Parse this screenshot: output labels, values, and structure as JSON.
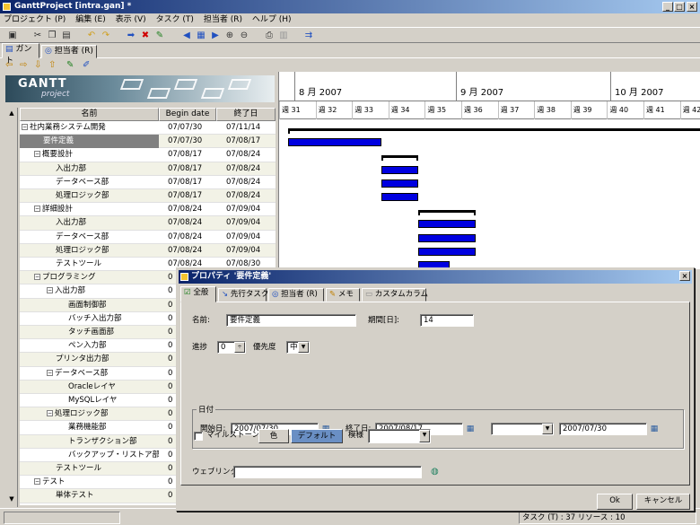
{
  "window": {
    "title": "GanttProject [intra.gan] *"
  },
  "menu": [
    "プロジェクト (P)",
    "編集 (E)",
    "表示 (V)",
    "タスク (T)",
    "担当者 (R)",
    "ヘルプ (H)"
  ],
  "tabs": [
    {
      "label": "ガント"
    },
    {
      "label": "担当者 (R)"
    }
  ],
  "logo": {
    "text": "GANTT",
    "sub": "project"
  },
  "table": {
    "headers": {
      "name": "名前",
      "begin": "Begin date",
      "end": "終了日"
    },
    "rows": [
      {
        "name": "社内業務システム開発",
        "begin": "07/07/30",
        "end": "07/11/14",
        "level": 0,
        "toggle": "−"
      },
      {
        "name": "要件定義",
        "begin": "07/07/30",
        "end": "07/08/17",
        "level": 1,
        "toggle": ""
      },
      {
        "name": "概要設計",
        "begin": "07/08/17",
        "end": "07/08/24",
        "level": 1,
        "toggle": "−"
      },
      {
        "name": "入出力部",
        "begin": "07/08/17",
        "end": "07/08/24",
        "level": 2,
        "toggle": ""
      },
      {
        "name": "データベース部",
        "begin": "07/08/17",
        "end": "07/08/24",
        "level": 2,
        "toggle": ""
      },
      {
        "name": "処理ロジック部",
        "begin": "07/08/17",
        "end": "07/08/24",
        "level": 2,
        "toggle": ""
      },
      {
        "name": "詳細設計",
        "begin": "07/08/24",
        "end": "07/09/04",
        "level": 1,
        "toggle": "−"
      },
      {
        "name": "入出力部",
        "begin": "07/08/24",
        "end": "07/09/04",
        "level": 2,
        "toggle": ""
      },
      {
        "name": "データベース部",
        "begin": "07/08/24",
        "end": "07/09/04",
        "level": 2,
        "toggle": ""
      },
      {
        "name": "処理ロジック部",
        "begin": "07/08/24",
        "end": "07/09/04",
        "level": 2,
        "toggle": ""
      },
      {
        "name": "テストツール",
        "begin": "07/08/24",
        "end": "07/08/30",
        "level": 2,
        "toggle": ""
      },
      {
        "name": "プログラミング",
        "begin": "0",
        "end": "",
        "level": 1,
        "toggle": "−"
      },
      {
        "name": "入出力部",
        "begin": "0",
        "end": "",
        "level": 2,
        "toggle": "−"
      },
      {
        "name": "画面制御部",
        "begin": "0",
        "end": "",
        "level": 3,
        "toggle": ""
      },
      {
        "name": "バッチ入出力部",
        "begin": "0",
        "end": "",
        "level": 3,
        "toggle": ""
      },
      {
        "name": "タッチ画面部",
        "begin": "0",
        "end": "",
        "level": 3,
        "toggle": ""
      },
      {
        "name": "ペン入力部",
        "begin": "0",
        "end": "",
        "level": 3,
        "toggle": ""
      },
      {
        "name": "プリンタ出力部",
        "begin": "0",
        "end": "",
        "level": 2,
        "toggle": ""
      },
      {
        "name": "データベース部",
        "begin": "0",
        "end": "",
        "level": 2,
        "toggle": "−"
      },
      {
        "name": "Oracleレイヤ",
        "begin": "0",
        "end": "",
        "level": 3,
        "toggle": ""
      },
      {
        "name": "MySQLレイヤ",
        "begin": "0",
        "end": "",
        "level": 3,
        "toggle": ""
      },
      {
        "name": "処理ロジック部",
        "begin": "0",
        "end": "",
        "level": 2,
        "toggle": "−"
      },
      {
        "name": "業務機能部",
        "begin": "0",
        "end": "",
        "level": 3,
        "toggle": ""
      },
      {
        "name": "トランザクション部",
        "begin": "0",
        "end": "",
        "level": 3,
        "toggle": ""
      },
      {
        "name": "バックアップ・リストア部",
        "begin": "0",
        "end": "",
        "level": 3,
        "toggle": ""
      },
      {
        "name": "テストツール",
        "begin": "0",
        "end": "",
        "level": 2,
        "toggle": ""
      },
      {
        "name": "テスト",
        "begin": "0",
        "end": "",
        "level": 1,
        "toggle": "−"
      },
      {
        "name": "単体テスト",
        "begin": "0",
        "end": "",
        "level": 2,
        "toggle": ""
      }
    ]
  },
  "gantt": {
    "months": [
      "8 月 2007",
      "9 月 2007",
      "10 月 2007"
    ],
    "weeks": [
      "週 31",
      "週 32",
      "週 33",
      "週 34",
      "週 35",
      "週 36",
      "週 37",
      "週 38",
      "週 39",
      "週 40",
      "週 41",
      "週 42"
    ]
  },
  "dialog": {
    "title": "プロパティ '要件定義'",
    "close": "×",
    "tabs": [
      "全般",
      "先行タスク",
      "担当者 (R)",
      "メモ",
      "カスタムカラム"
    ],
    "name_label": "名前:",
    "name_value": "要件定義",
    "duration_label": "期間[日]:",
    "duration_value": "14",
    "progress_label": "進捗",
    "progress_value": "0",
    "priority_label": "優先度",
    "priority_value": "中",
    "date_group": "日付",
    "start_label": "開始日:",
    "start_value": "2007/07/30",
    "end_label": "終了日:",
    "end_value": "2007/08/17",
    "third_date_value": "2007/07/30",
    "milestone_label": "マイルストーン",
    "color_button": "色",
    "default_button": "デフォルト",
    "pattern_label": "模様",
    "weblink_label": "ウェブリンク",
    "ok": "Ok",
    "cancel": "キャンセル"
  },
  "status": {
    "text": "タスク (T) : 37  リソース : 10"
  }
}
